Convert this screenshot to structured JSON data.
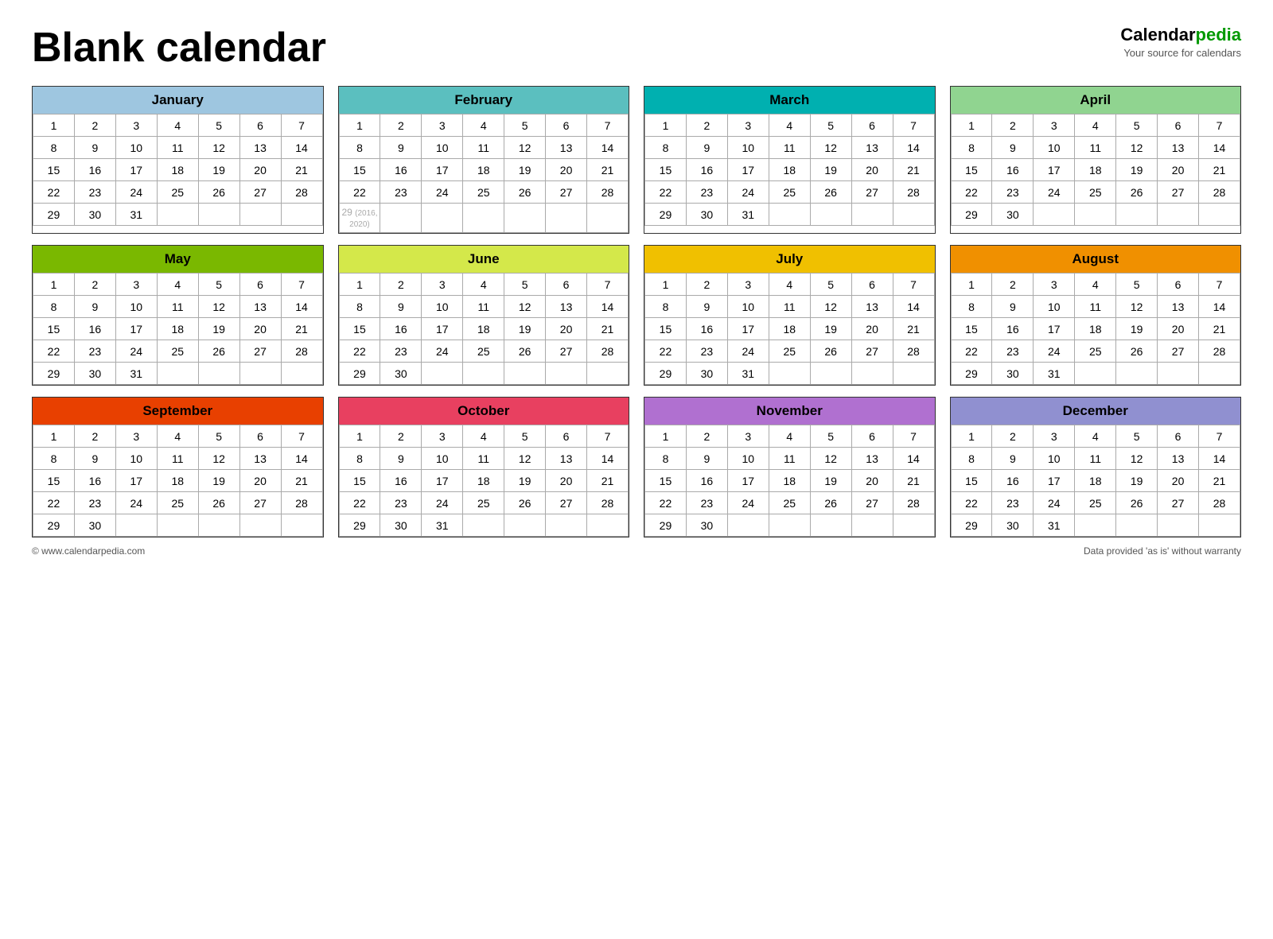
{
  "title": "Blank calendar",
  "brand": {
    "name_part1": "Calendar",
    "name_part2": "pedia",
    "tagline": "Your source for calendars"
  },
  "months": [
    {
      "name": "January",
      "class": "january",
      "weeks": [
        [
          1,
          2,
          3,
          4,
          5,
          6,
          7
        ],
        [
          8,
          9,
          10,
          11,
          12,
          13,
          14
        ],
        [
          15,
          16,
          17,
          18,
          19,
          20,
          21
        ],
        [
          22,
          23,
          24,
          25,
          26,
          27,
          28
        ],
        [
          29,
          30,
          31,
          null,
          null,
          null,
          null
        ]
      ]
    },
    {
      "name": "February",
      "class": "february",
      "weeks": [
        [
          1,
          2,
          3,
          4,
          5,
          6,
          7
        ],
        [
          8,
          9,
          10,
          11,
          12,
          13,
          14
        ],
        [
          15,
          16,
          17,
          18,
          19,
          20,
          21
        ],
        [
          22,
          23,
          24,
          25,
          26,
          27,
          28
        ],
        [
          "29_leap",
          null,
          null,
          null,
          null,
          null,
          null
        ]
      ]
    },
    {
      "name": "March",
      "class": "march",
      "weeks": [
        [
          1,
          2,
          3,
          4,
          5,
          6,
          7
        ],
        [
          8,
          9,
          10,
          11,
          12,
          13,
          14
        ],
        [
          15,
          16,
          17,
          18,
          19,
          20,
          21
        ],
        [
          22,
          23,
          24,
          25,
          26,
          27,
          28
        ],
        [
          29,
          30,
          31,
          null,
          null,
          null,
          null
        ]
      ]
    },
    {
      "name": "April",
      "class": "april",
      "weeks": [
        [
          1,
          2,
          3,
          4,
          5,
          6,
          7
        ],
        [
          8,
          9,
          10,
          11,
          12,
          13,
          14
        ],
        [
          15,
          16,
          17,
          18,
          19,
          20,
          21
        ],
        [
          22,
          23,
          24,
          25,
          26,
          27,
          28
        ],
        [
          29,
          30,
          null,
          null,
          null,
          null,
          null
        ]
      ]
    },
    {
      "name": "May",
      "class": "may",
      "weeks": [
        [
          1,
          2,
          3,
          4,
          5,
          6,
          7
        ],
        [
          8,
          9,
          10,
          11,
          12,
          13,
          14
        ],
        [
          15,
          16,
          17,
          18,
          19,
          20,
          21
        ],
        [
          22,
          23,
          24,
          25,
          26,
          27,
          28
        ],
        [
          29,
          30,
          31,
          null,
          null,
          null,
          null
        ]
      ]
    },
    {
      "name": "June",
      "class": "june",
      "weeks": [
        [
          1,
          2,
          3,
          4,
          5,
          6,
          7
        ],
        [
          8,
          9,
          10,
          11,
          12,
          13,
          14
        ],
        [
          15,
          16,
          17,
          18,
          19,
          20,
          21
        ],
        [
          22,
          23,
          24,
          25,
          26,
          27,
          28
        ],
        [
          29,
          30,
          null,
          null,
          null,
          null,
          null
        ]
      ]
    },
    {
      "name": "July",
      "class": "july",
      "weeks": [
        [
          1,
          2,
          3,
          4,
          5,
          6,
          7
        ],
        [
          8,
          9,
          10,
          11,
          12,
          13,
          14
        ],
        [
          15,
          16,
          17,
          18,
          19,
          20,
          21
        ],
        [
          22,
          23,
          24,
          25,
          26,
          27,
          28
        ],
        [
          29,
          30,
          31,
          null,
          null,
          null,
          null
        ]
      ]
    },
    {
      "name": "August",
      "class": "august",
      "weeks": [
        [
          1,
          2,
          3,
          4,
          5,
          6,
          7
        ],
        [
          8,
          9,
          10,
          11,
          12,
          13,
          14
        ],
        [
          15,
          16,
          17,
          18,
          19,
          20,
          21
        ],
        [
          22,
          23,
          24,
          25,
          26,
          27,
          28
        ],
        [
          29,
          30,
          31,
          null,
          null,
          null,
          null
        ]
      ]
    },
    {
      "name": "September",
      "class": "september",
      "weeks": [
        [
          1,
          2,
          3,
          4,
          5,
          6,
          7
        ],
        [
          8,
          9,
          10,
          11,
          12,
          13,
          14
        ],
        [
          15,
          16,
          17,
          18,
          19,
          20,
          21
        ],
        [
          22,
          23,
          24,
          25,
          26,
          27,
          28
        ],
        [
          29,
          30,
          null,
          null,
          null,
          null,
          null
        ]
      ]
    },
    {
      "name": "October",
      "class": "october",
      "weeks": [
        [
          1,
          2,
          3,
          4,
          5,
          6,
          7
        ],
        [
          8,
          9,
          10,
          11,
          12,
          13,
          14
        ],
        [
          15,
          16,
          17,
          18,
          19,
          20,
          21
        ],
        [
          22,
          23,
          24,
          25,
          26,
          27,
          28
        ],
        [
          29,
          30,
          31,
          null,
          null,
          null,
          null
        ]
      ]
    },
    {
      "name": "November",
      "class": "november",
      "weeks": [
        [
          1,
          2,
          3,
          4,
          5,
          6,
          7
        ],
        [
          8,
          9,
          10,
          11,
          12,
          13,
          14
        ],
        [
          15,
          16,
          17,
          18,
          19,
          20,
          21
        ],
        [
          22,
          23,
          24,
          25,
          26,
          27,
          28
        ],
        [
          29,
          30,
          null,
          null,
          null,
          null,
          null
        ]
      ]
    },
    {
      "name": "December",
      "class": "december",
      "weeks": [
        [
          1,
          2,
          3,
          4,
          5,
          6,
          7
        ],
        [
          8,
          9,
          10,
          11,
          12,
          13,
          14
        ],
        [
          15,
          16,
          17,
          18,
          19,
          20,
          21
        ],
        [
          22,
          23,
          24,
          25,
          26,
          27,
          28
        ],
        [
          29,
          30,
          31,
          null,
          null,
          null,
          null
        ]
      ]
    }
  ],
  "footer": {
    "left": "© www.calendarpedia.com",
    "right": "Data provided 'as is' without warranty"
  }
}
